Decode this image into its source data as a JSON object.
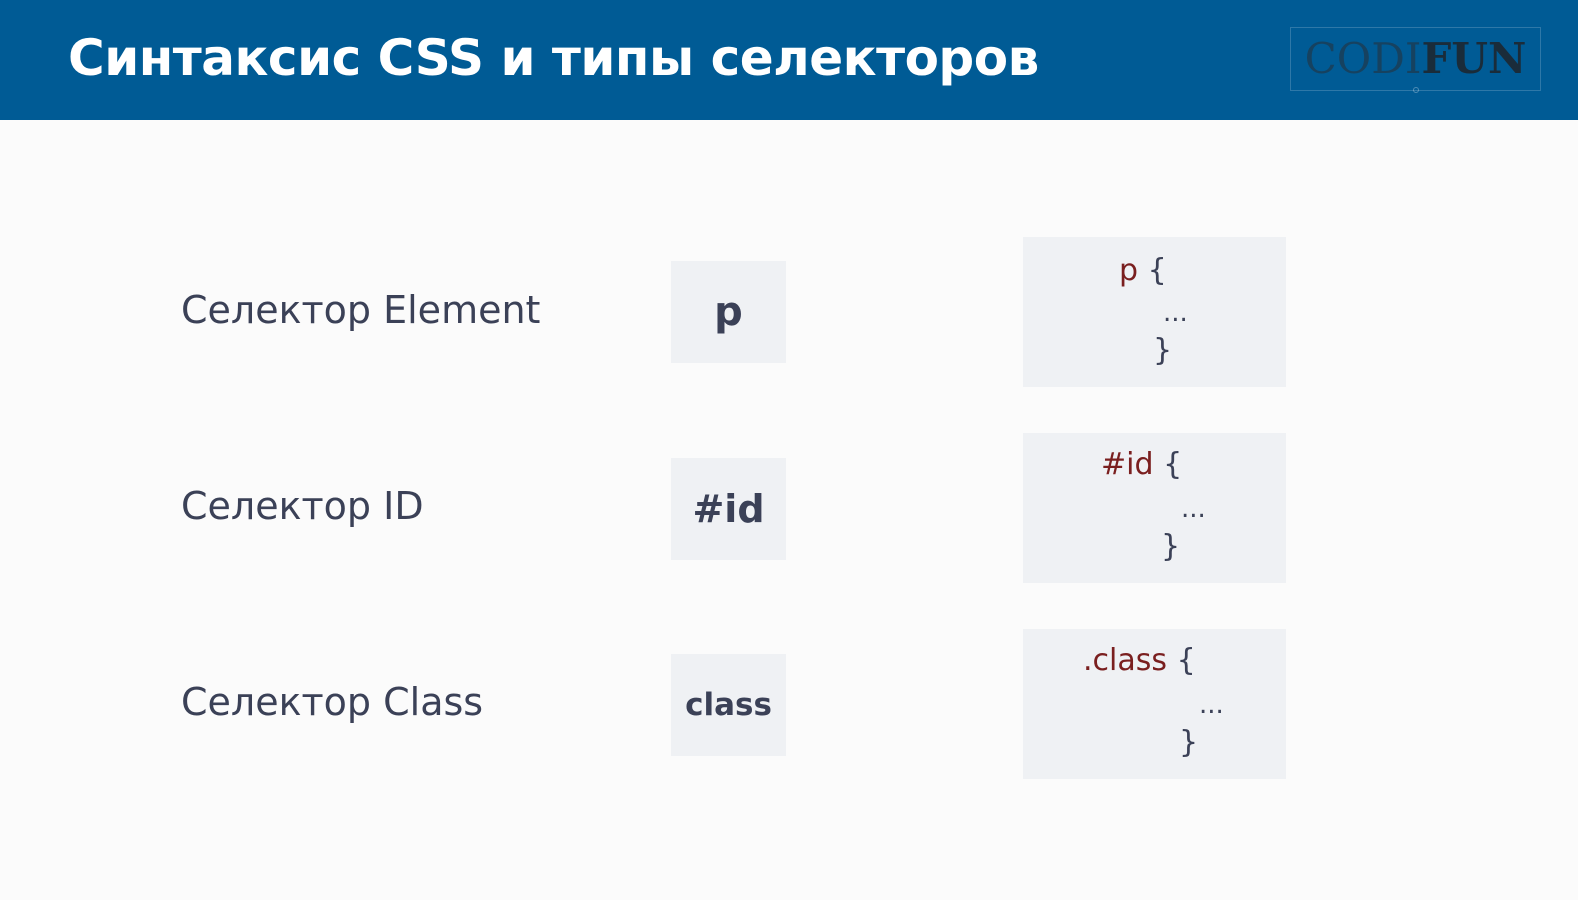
{
  "header": {
    "title": "Синтаксис CSS и типы селекторов",
    "logo_light": "CODI",
    "logo_bold": "FUN"
  },
  "rows": [
    {
      "label": "Селектор Element",
      "selector": "p",
      "code_selector": "p",
      "code_open": "{",
      "code_body": "...",
      "code_close": "}"
    },
    {
      "label": "Селектор ID",
      "selector": "#id",
      "code_selector": "#id",
      "code_open": "{",
      "code_body": "...",
      "code_close": "}"
    },
    {
      "label": "Селектор Class",
      "selector": "class",
      "code_selector": ".class",
      "code_open": "{",
      "code_body": "...",
      "code_close": "}"
    }
  ],
  "colors": {
    "header_bg": "#005b95",
    "text": "#3b4157",
    "selector_name": "#7a1f1f",
    "box_bg": "#eff1f4"
  }
}
